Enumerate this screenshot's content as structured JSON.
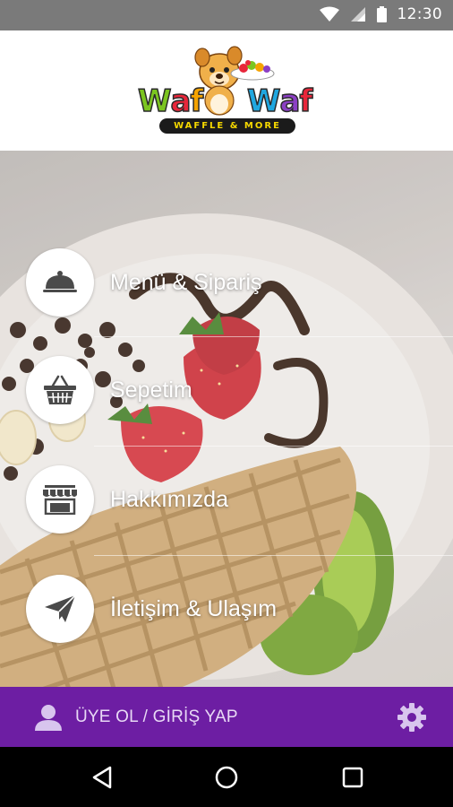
{
  "status_bar": {
    "time": "12:30",
    "icons": [
      "wifi-icon",
      "signal-icon",
      "battery-icon"
    ]
  },
  "header": {
    "logo": {
      "word_left": [
        "W",
        "a",
        "f"
      ],
      "word_right": [
        "W",
        "a",
        "f"
      ],
      "tagline": "WAFFLE & MORE",
      "letter_colors": [
        "#7cc520",
        "#e8263a",
        "#f5a300",
        "#1fa7e0",
        "#8b3fc4",
        "#e8263a"
      ]
    }
  },
  "menu": {
    "items": [
      {
        "label": "Menü & Sipariş",
        "icon": "cloche-icon"
      },
      {
        "label": "Sepetim",
        "icon": "basket-icon"
      },
      {
        "label": "Hakkımızda",
        "icon": "storefront-icon"
      },
      {
        "label": "İletişim & Ulaşım",
        "icon": "paper-plane-icon"
      }
    ]
  },
  "bottom_bar": {
    "login_label": "ÜYE OL / GİRİŞ YAP",
    "user_icon": "user-icon",
    "settings_icon": "gear-icon",
    "color": "#6d1ea3"
  },
  "nav_bar": {
    "buttons": [
      "back-icon",
      "home-icon",
      "recents-icon"
    ]
  }
}
